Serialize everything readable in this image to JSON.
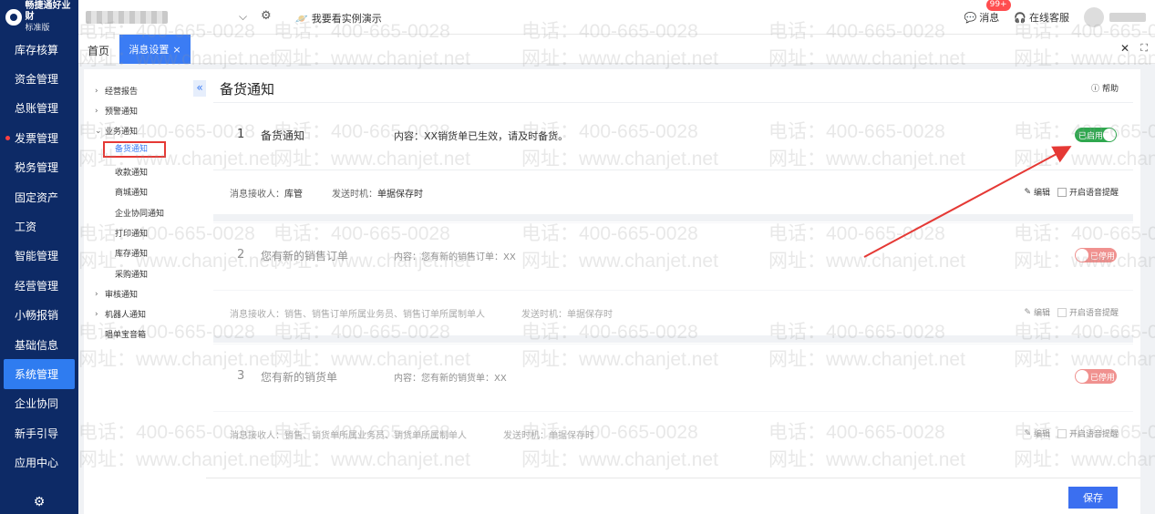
{
  "brand": {
    "name": "畅捷通好业财",
    "edition": "标准版"
  },
  "nav": [
    {
      "label": "库存核算"
    },
    {
      "label": "资金管理"
    },
    {
      "label": "总账管理"
    },
    {
      "label": "发票管理",
      "dot": true
    },
    {
      "label": "税务管理"
    },
    {
      "label": "固定资产"
    },
    {
      "label": "工资"
    },
    {
      "label": "智能管理"
    },
    {
      "label": "经营管理"
    },
    {
      "label": "小畅报销"
    },
    {
      "label": "基础信息"
    },
    {
      "label": "系统管理",
      "active": true
    },
    {
      "label": "企业协同"
    },
    {
      "label": "新手引导"
    },
    {
      "label": "应用中心"
    }
  ],
  "topbar": {
    "demo_label": "我要看实例演示",
    "msg_label": "消息",
    "msg_badge": "99+",
    "service_label": "在线客服"
  },
  "tabs": {
    "home": "首页",
    "active": "消息设置"
  },
  "tree": {
    "groups": [
      {
        "label": "经营报告",
        "expanded": false
      },
      {
        "label": "预警通知",
        "expanded": false
      },
      {
        "label": "业务通知",
        "expanded": true
      },
      {
        "label": "审核通知",
        "expanded": false
      },
      {
        "label": "机器人通知",
        "expanded": false
      }
    ],
    "children": [
      "备货通知",
      "收款通知",
      "商城通知",
      "企业协同通知",
      "打印通知",
      "库存通知",
      "采购通知"
    ],
    "selected": "备货通知",
    "extra": "唱单宝音箱"
  },
  "main": {
    "title": "备货通知",
    "help_label": "帮助"
  },
  "cards": [
    {
      "num": "1",
      "name": "备货通知",
      "content": "内容：XX销货单已生效，请及时备货。",
      "recv": "消息接收人：",
      "recv_value": "库管",
      "time": "发送时机：",
      "time_value": "单据保存时",
      "status": "已启用",
      "enabled": true
    },
    {
      "num": "2",
      "name": "您有新的销售订单",
      "content": "内容：您有新的销售订单：XX",
      "recv": "消息接收人：",
      "recv_value": "销售、销售订单所属业务员、销售订单所属制单人",
      "time": "发送时机：",
      "time_value": "单据保存时",
      "status": "已停用",
      "enabled": false
    },
    {
      "num": "3",
      "name": "您有新的销货单",
      "content": "内容：您有新的销货单：XX",
      "recv": "消息接收人：",
      "recv_value": "销售、销货单所属业务员、销货单所属制单人",
      "time": "发送时机：",
      "time_value": "单据保存时",
      "status": "已停用",
      "enabled": false
    }
  ],
  "card_actions": {
    "edit": "编辑",
    "voice": "开启语音提醒"
  },
  "footer": {
    "save": "保存"
  },
  "watermark": {
    "phone": "电话：400-665-0028",
    "site": "网址：www.chanjet.net"
  },
  "colors": {
    "nav_bg": "#0d2a66",
    "accent": "#3b7cf4",
    "enabled": "#2fa84f",
    "disabled": "#e53935"
  }
}
